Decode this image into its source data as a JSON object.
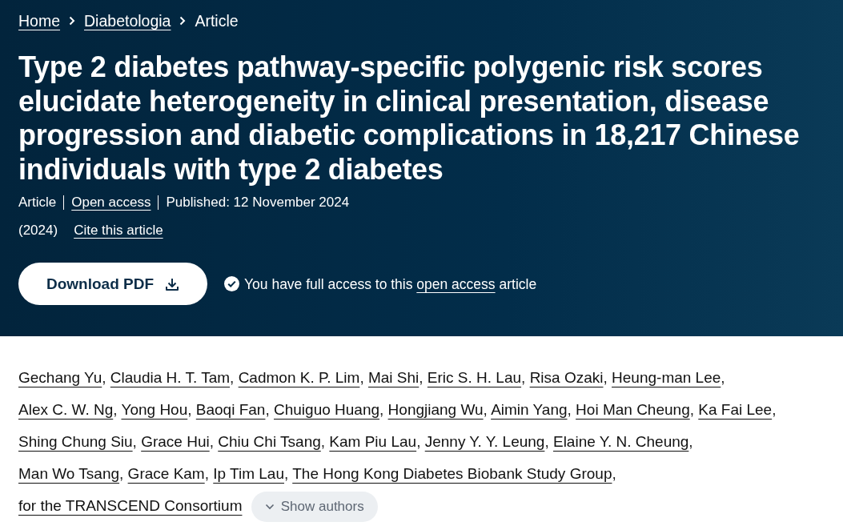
{
  "breadcrumb": [
    {
      "label": "Home",
      "current": false
    },
    {
      "label": "Diabetologia",
      "current": false
    },
    {
      "label": "Article",
      "current": true
    }
  ],
  "article": {
    "title": "Type 2 diabetes pathway-specific polygenic risk scores elucidate heterogeneity in clinical presentation, disease progression and diabetic complications in 18,217 Chinese individuals with type 2 diabetes",
    "type": "Article",
    "access": "Open access",
    "published": "Published: 12 November 2024",
    "year": "(2024)",
    "cite_link": "Cite this article"
  },
  "download_button": {
    "label": "Download PDF"
  },
  "access_note": {
    "text_before": "You have full access to this",
    "link": "open access",
    "text_after": "article"
  },
  "authors": {
    "names": [
      "Gechang Yu",
      "Claudia H. T. Tam",
      "Cadmon K. P. Lim",
      "Mai Shi",
      "Eric S. H. Lau",
      "Risa Ozaki",
      "Heung-man Lee",
      "Alex C. W. Ng",
      "Yong Hou",
      "Baoqi Fan",
      "Chuiguo Huang",
      "Hongjiang Wu",
      "Aimin Yang",
      "Hoi Man Cheung",
      "Ka Fai Lee",
      "Shing Chung Siu",
      "Grace Hui",
      "Chiu Chi Tsang",
      "Kam Piu Lau",
      "Jenny Y. Y. Leung",
      "Elaine Y. N. Cheung",
      "Man Wo Tsang",
      "Grace Kam",
      "Ip Tim Lau",
      "The Hong Kong Diabetes Biobank Study Group",
      "for the TRANSCEND Consortium"
    ],
    "separator": ",",
    "toggle": {
      "label": "Show authors",
      "expanded": false
    }
  }
}
